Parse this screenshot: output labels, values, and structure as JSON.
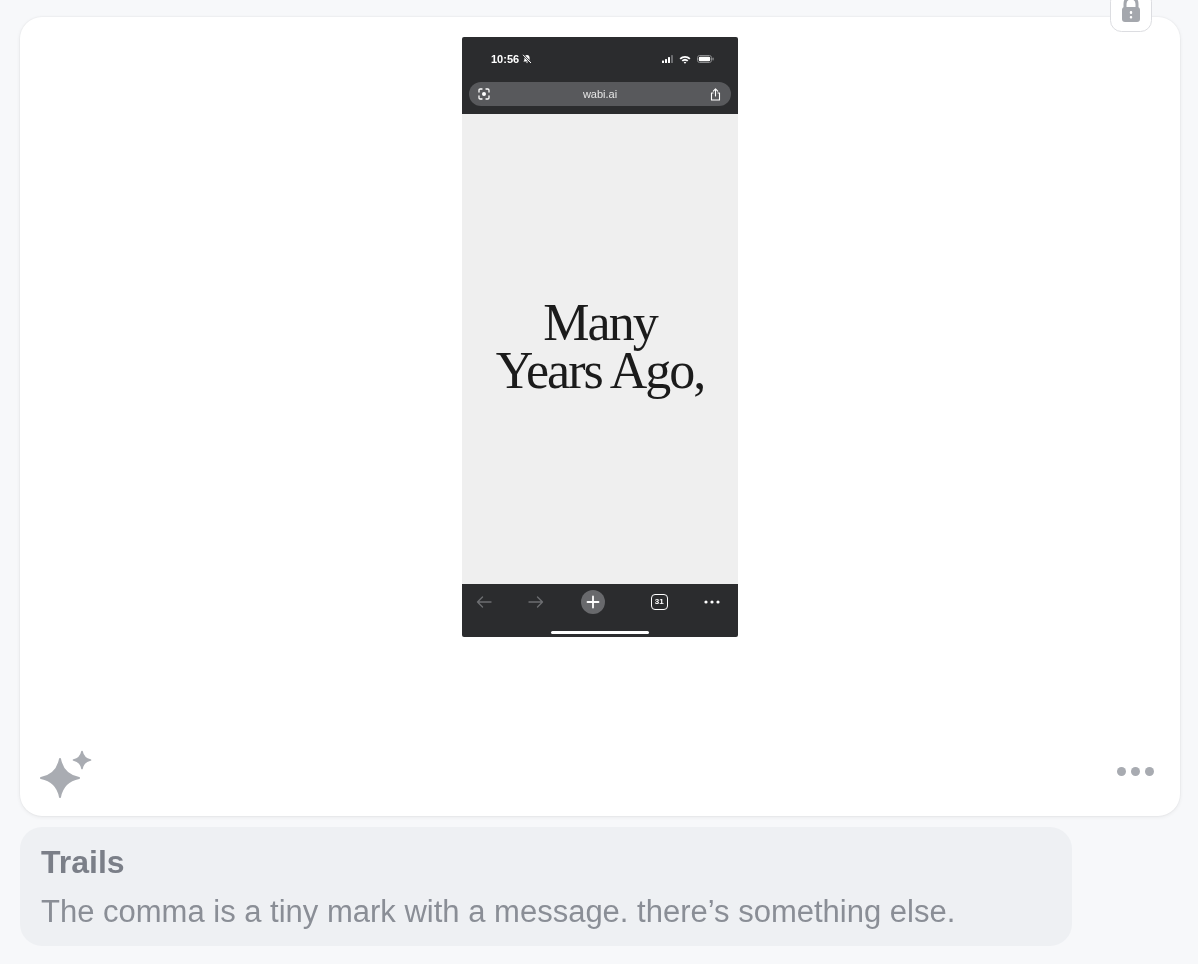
{
  "post": {
    "screenshot": {
      "status_bar": {
        "time": "10:56"
      },
      "address_bar": {
        "url": "wabi.ai"
      },
      "page": {
        "headline": "Many Years Ago,"
      },
      "toolbar": {
        "tab_count": "31"
      }
    }
  },
  "caption": {
    "title": "Trails",
    "text": "The comma is a tiny mark with a message. there’s something else."
  }
}
